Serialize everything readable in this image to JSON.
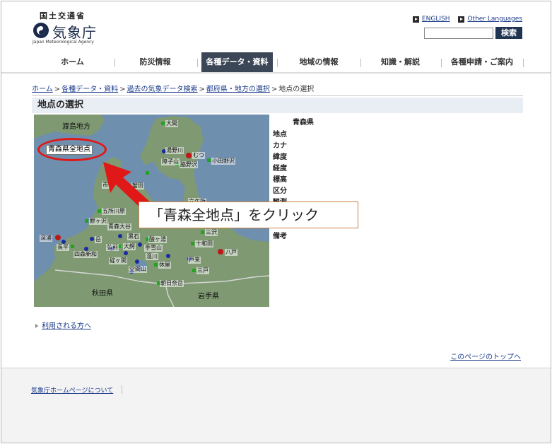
{
  "header": {
    "ministry": "国土交通省",
    "agency": "気象庁",
    "agency_en": "Japan Meteorological Agency",
    "english_link": "ENGLISH",
    "other_languages_link": "Other Languages",
    "search_placeholder": "",
    "search_button": "検索"
  },
  "nav": {
    "items": [
      {
        "label": "ホーム"
      },
      {
        "label": "防災情報"
      },
      {
        "label": "各種データ・資料"
      },
      {
        "label": "地域の情報"
      },
      {
        "label": "知識・解説"
      },
      {
        "label": "各種申請・ご案内"
      }
    ],
    "active_index": 2
  },
  "breadcrumb": {
    "items": [
      "ホーム",
      "各種データ・資料",
      "過去の気象データ検索",
      "都府県・地方の選択"
    ],
    "current": "地点の選択",
    "separator": ">"
  },
  "section_title": "地点の選択",
  "map": {
    "region_labels": {
      "oshima": "渡島地方",
      "akita": "秋田県",
      "iwate": "岩手県"
    },
    "all_points_button": "青森県全地点",
    "stations": [
      "大間",
      "湯野川",
      "むつ",
      "小田野沢",
      "脇野沢",
      "市",
      "蟹田",
      "五所川原",
      "鰺ヶ沢",
      "青森大谷",
      "深浦",
      "岳",
      "黒石",
      "長平",
      "四森新和",
      "弘前",
      "大鰐",
      "酸ヶ湯",
      "碇ヶ関",
      "三沢",
      "十和田",
      "八戸",
      "三戸",
      "戸来",
      "休屋",
      "朝日奈岳",
      "温川",
      "空間山",
      "手雪山",
      "障子山",
      "六ケ所"
    ],
    "colors": {
      "sea": "#6f8fae",
      "land": "#7f9a72",
      "accent": "#e01818"
    }
  },
  "info": {
    "prefecture": "青森県",
    "fields": [
      "地点",
      "カナ",
      "緯度",
      "経度",
      "標高",
      "区分",
      "観測",
      "",
      "",
      "備考"
    ]
  },
  "annotation": {
    "text": "「青森全地点」をクリック"
  },
  "links": {
    "users": "利用される方へ",
    "page_top": "このページのトップへ",
    "about": "気象庁ホームページについて"
  }
}
